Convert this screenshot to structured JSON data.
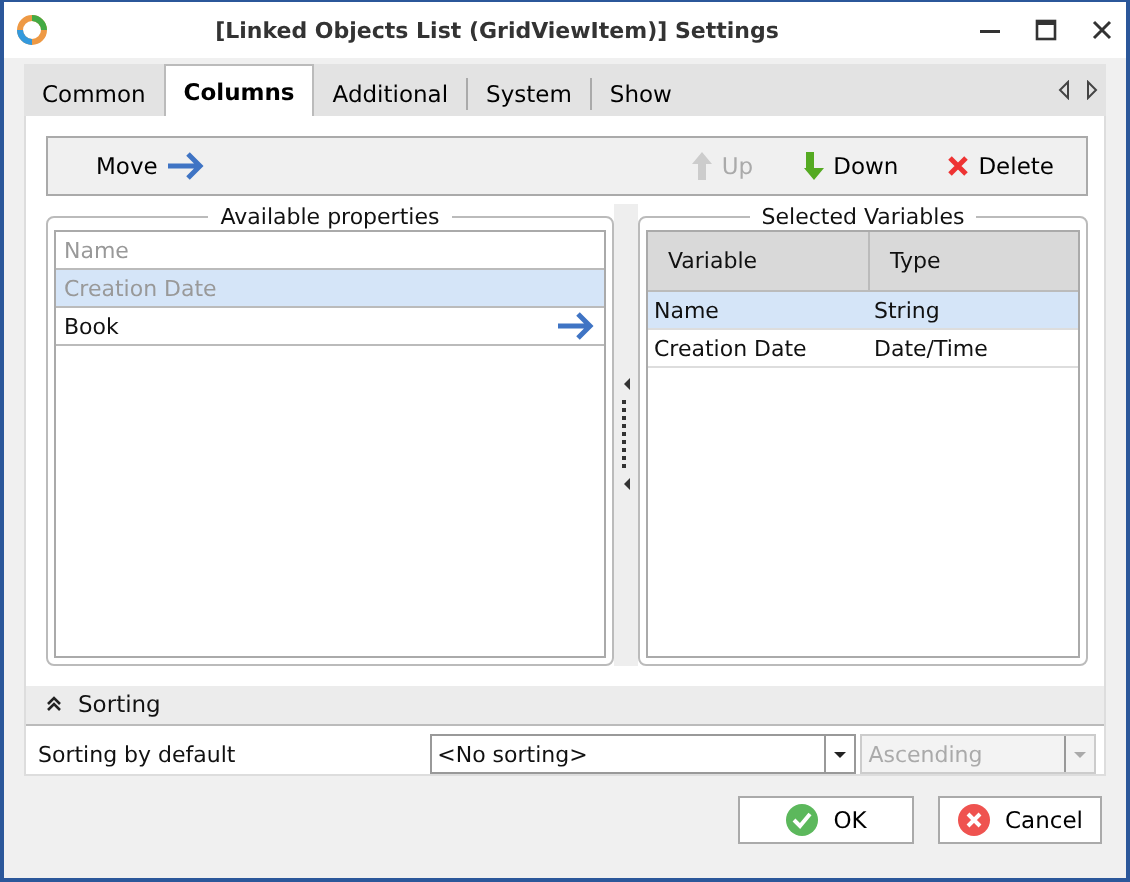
{
  "window": {
    "title": "[Linked Objects List (GridViewItem)] Settings"
  },
  "tabs": [
    {
      "label": "Common",
      "selected": false
    },
    {
      "label": "Columns",
      "selected": true
    },
    {
      "label": "Additional",
      "selected": false
    },
    {
      "label": "System",
      "selected": false
    },
    {
      "label": "Show",
      "selected": false
    }
  ],
  "toolbar": [
    {
      "kind": "move",
      "label": "Move",
      "disabled": false
    },
    {
      "kind": "up",
      "label": "Up",
      "disabled": true
    },
    {
      "kind": "down",
      "label": "Down",
      "disabled": false
    },
    {
      "kind": "delete",
      "label": "Delete",
      "disabled": false
    }
  ],
  "available": {
    "title": "Available properties",
    "items": [
      {
        "label": "Name",
        "disabled": true,
        "selected": false
      },
      {
        "label": "Creation Date",
        "disabled": true,
        "selected": true
      },
      {
        "label": "Book",
        "disabled": false,
        "selected": false
      }
    ]
  },
  "selected_vars": {
    "title": "Selected Variables",
    "columns": [
      "Variable",
      "Type"
    ],
    "rows": [
      {
        "cells": [
          "Name",
          "String"
        ],
        "selected": true
      },
      {
        "cells": [
          "Creation Date",
          "Date/Time"
        ],
        "selected": false
      }
    ]
  },
  "sorting": {
    "header": "Sorting",
    "expanded": true,
    "label": "Sorting by default",
    "field": "<No sorting>",
    "order": "Ascending",
    "order_disabled": true
  },
  "buttons": [
    {
      "kind": "ok",
      "label": "OK"
    },
    {
      "kind": "cancel",
      "label": "Cancel"
    }
  ]
}
